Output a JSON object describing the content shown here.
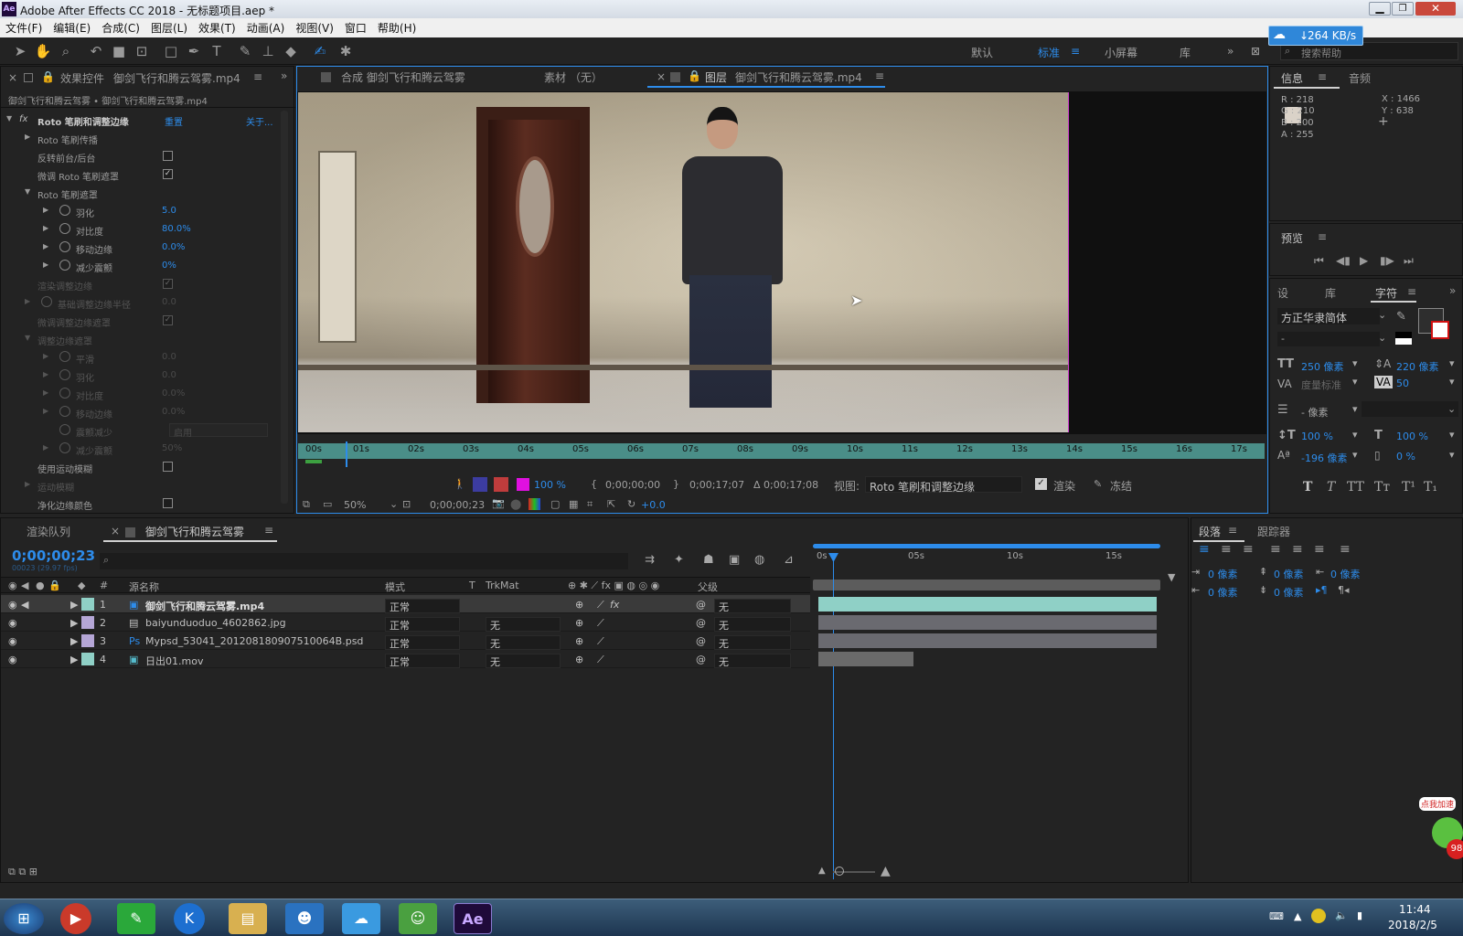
{
  "window": {
    "app_title": "Adobe After Effects CC 2018 - 无标题项目.aep *"
  },
  "menu": [
    "文件(F)",
    "编辑(E)",
    "合成(C)",
    "图层(L)",
    "效果(T)",
    "动画(A)",
    "视图(V)",
    "窗口",
    "帮助(H)"
  ],
  "workspaces": {
    "default": "默认",
    "standard": "标准",
    "small": "小屏幕",
    "library": "库",
    "search_placeholder": "搜索帮助"
  },
  "net_speed": "264 KB/s",
  "effects_panel": {
    "tab": "效果控件",
    "tab_file": "御剑飞行和腾云驾雾.mp4",
    "breadcrumb": "御剑飞行和腾云驾雾 • 御剑飞行和腾云驾雾.mp4",
    "effect_name": "Roto 笔刷和调整边缘",
    "reset": "重置",
    "about": "关于...",
    "rows": [
      {
        "label": "Roto 笔刷传播",
        "value": ""
      },
      {
        "label": "反转前台/后台",
        "value": ""
      },
      {
        "label": "微调 Roto 笔刷遮罩",
        "value": ""
      },
      {
        "label": "Roto 笔刷遮罩",
        "value": ""
      },
      {
        "label": "羽化",
        "value": "5.0"
      },
      {
        "label": "对比度",
        "value": "80.0%"
      },
      {
        "label": "移动边缘",
        "value": "0.0%"
      },
      {
        "label": "减少震颤",
        "value": "0%"
      },
      {
        "label": "渲染调整边缘",
        "value": ""
      },
      {
        "label": "基础调整边缘半径",
        "value": "0.0"
      },
      {
        "label": "微调调整边缘遮罩",
        "value": ""
      },
      {
        "label": "调整边缘遮罩",
        "value": ""
      },
      {
        "label": "平滑",
        "value": "0.0"
      },
      {
        "label": "羽化",
        "value": "0.0"
      },
      {
        "label": "对比度",
        "value": "0.0%"
      },
      {
        "label": "移动边缘",
        "value": "0.0%"
      },
      {
        "label": "震颤减少",
        "value": "启用"
      },
      {
        "label": "减少震颤",
        "value": "50%"
      },
      {
        "label": "使用运动模糊",
        "value": ""
      },
      {
        "label": "运动模糊",
        "value": ""
      },
      {
        "label": "净化边缘颜色",
        "value": ""
      }
    ]
  },
  "viewer_tabs": {
    "comp_tab": "合成 御剑飞行和腾云驾雾",
    "footage_tab": "素材 （无）",
    "layer_tab_prefix": "图层",
    "layer_tab_file": "御剑飞行和腾云驾雾.mp4"
  },
  "viewer_ruler": [
    "00s",
    "01s",
    "02s",
    "03s",
    "04s",
    "05s",
    "06s",
    "07s",
    "08s",
    "09s",
    "10s",
    "11s",
    "12s",
    "13s",
    "14s",
    "15s",
    "16s",
    "17s"
  ],
  "viewer_controls": {
    "zoom_pct": "100 %",
    "in_time": "0;00;00;00",
    "out_time": "0;00;17;07",
    "duration": "Δ 0;00;17;08",
    "view_label": "视图:",
    "view_value": "Roto 笔刷和调整边缘",
    "render": "渲染",
    "freeze": "冻结",
    "mag": "50%",
    "current_time": "0;00;00;23",
    "exposure": "+0.0"
  },
  "info_panel": {
    "tab_info": "信息",
    "tab_audio": "音频",
    "r": "R : 218",
    "g": "G : 210",
    "b": "B : 200",
    "a": "A : 255",
    "x": "X : 1466",
    "y": "Y : 638",
    "swatch": "#dad2c8"
  },
  "preview_panel": {
    "title": "预览"
  },
  "char_panel": {
    "tab_a": "设",
    "tab_b": "库",
    "tab_char": "字符",
    "font": "方正华隶简体",
    "style": "-",
    "size": "250 像素",
    "leading": "220 像素",
    "kerning": "度量标准",
    "tracking": "50",
    "stroke": "- 像素",
    "vscale": "100 %",
    "hscale": "100 %",
    "baseline": "-196 像素",
    "tsume": "0 %",
    "buttons": [
      "T",
      "T",
      "TT",
      "Tт",
      "T¹",
      "T₁"
    ]
  },
  "paragraph_panel": {
    "tab": "段落",
    "tracker": "跟踪器",
    "indent_values": [
      "0 像素",
      "0 像素",
      "0 像素",
      "0 像素",
      "0 像素"
    ]
  },
  "timeline": {
    "render_queue": "渲染队列",
    "comp_tab": "御剑飞行和腾云驾雾",
    "timecode": "0;00;00;23",
    "frames": "00023 (29.97 fps)",
    "headers": {
      "name": "源名称",
      "mode": "模式",
      "t": "T",
      "trkmat": "TrkMat",
      "parent": "父级"
    },
    "ruler": [
      "0s",
      "05s",
      "10s",
      "15s"
    ],
    "layers": [
      {
        "num": "1",
        "name": "御剑飞行和腾云驾雾.mp4",
        "mode": "正常",
        "trk": "",
        "parent": "无",
        "color": "#8fd0c6",
        "bar_end": 1.0
      },
      {
        "num": "2",
        "name": "baiyunduoduo_4602862.jpg",
        "mode": "正常",
        "trk": "无",
        "parent": "无",
        "color": "#b5a6d6",
        "bar_end": 1.0
      },
      {
        "num": "3",
        "name": "Mypsd_53041_201208180907510064B.psd",
        "mode": "正常",
        "trk": "无",
        "parent": "无",
        "color": "#b5a6d6",
        "bar_end": 1.0
      },
      {
        "num": "4",
        "name": "日出01.mov",
        "mode": "正常",
        "trk": "无",
        "parent": "无",
        "color": "#8fd0c6",
        "bar_end": 0.28
      }
    ]
  },
  "taskbar": {
    "time": "11:44",
    "date": "2018/2/5",
    "promo": "点我加速",
    "promo_num": "98"
  }
}
